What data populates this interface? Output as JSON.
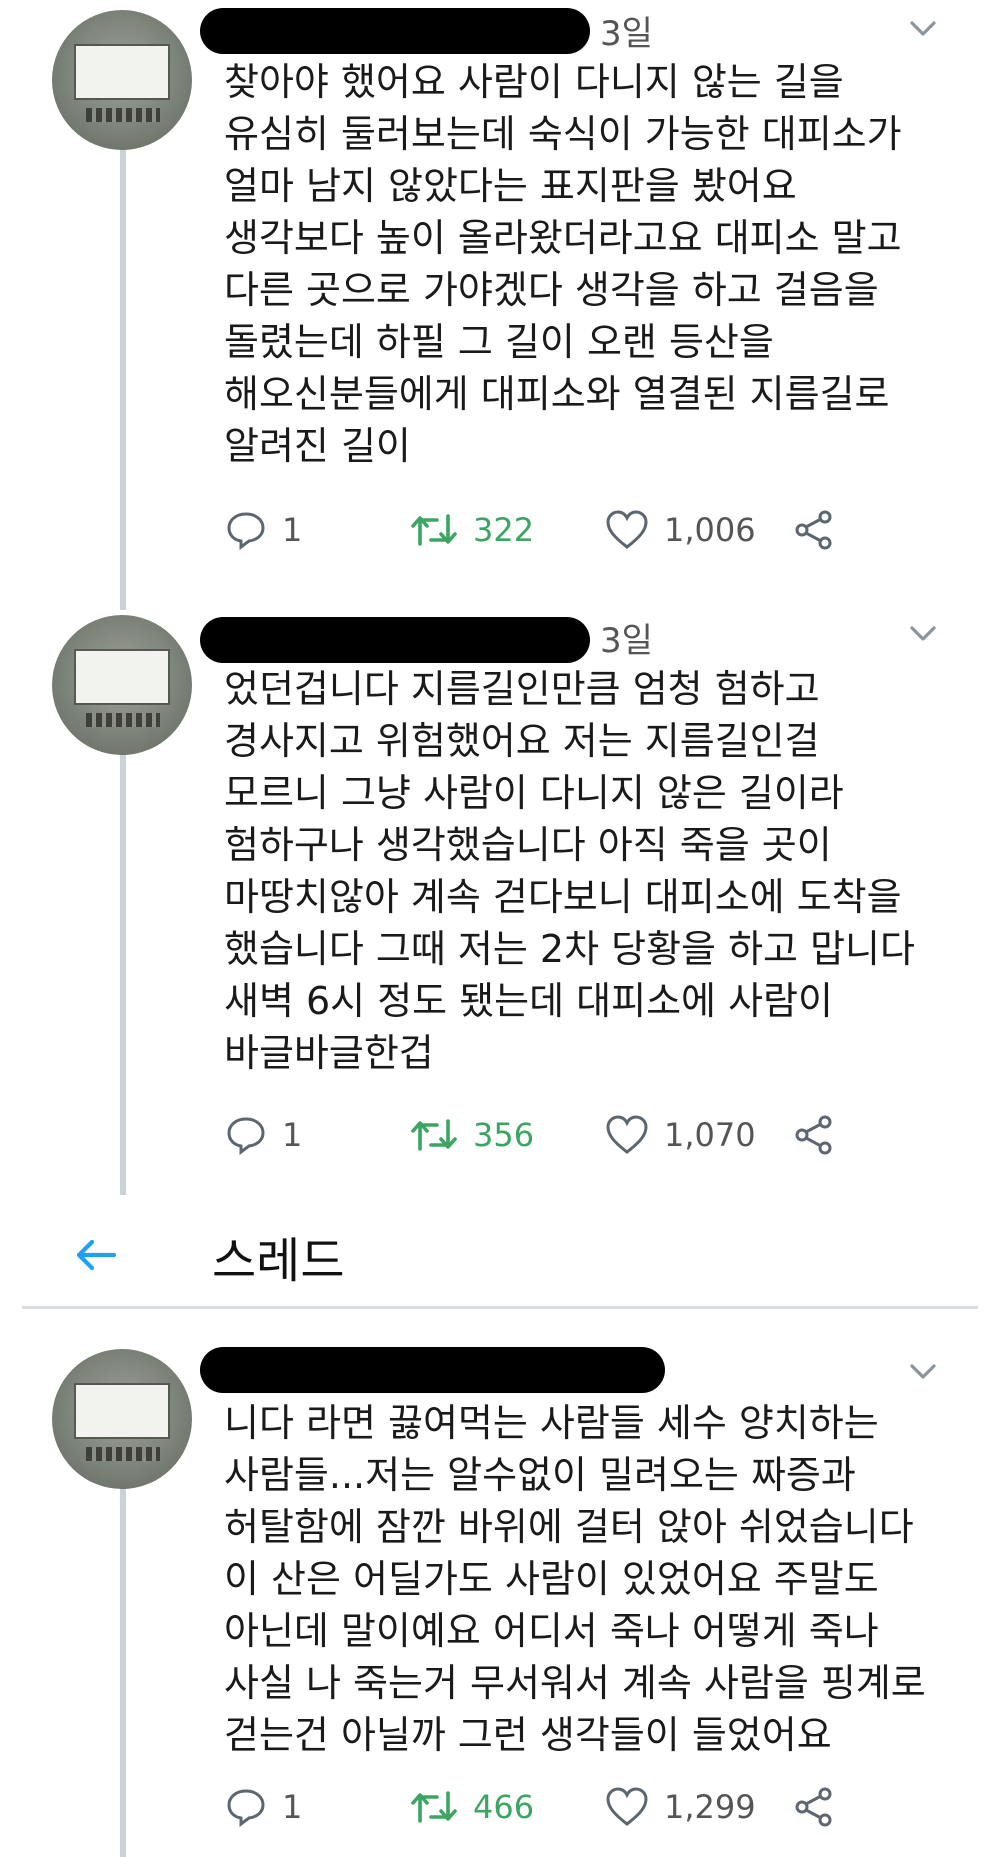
{
  "header": {
    "title": "스레드"
  },
  "tweets": [
    {
      "time": "3일",
      "lines": [
        "찾아야 했어요 사람이 다니지 않는 길을",
        "유심히 둘러보는데 숙식이 가능한 대피소가",
        "얼마 남지 않았다는 표지판을 봤어요",
        "생각보다 높이 올라왔더라고요 대피소 말고",
        "다른 곳으로 가야겠다 생각을 하고 걸음을",
        "돌렸는데 하필 그 길이 오랜 등산을",
        "해오신분들에게 대피소와 열결된 지름길로",
        "알려진 길이"
      ],
      "replies": "1",
      "retweets": "322",
      "likes": "1,006"
    },
    {
      "time": "3일",
      "lines": [
        "었던겁니다 지름길인만큼 엄청 험하고",
        "경사지고 위험했어요 저는 지름길인걸",
        "모르니 그냥 사람이 다니지 않은 길이라",
        "험하구나 생각했습니다 아직 죽을 곳이",
        "마땅치않아 계속 걷다보니 대피소에 도착을",
        "했습니다 그때 저는 2차 당황을 하고 맙니다",
        "새벽 6시 정도 됐는데 대피소에 사람이",
        "바글바글한겁"
      ],
      "replies": "1",
      "retweets": "356",
      "likes": "1,070"
    },
    {
      "time": "",
      "lines": [
        "니다 라면 끓여먹는 사람들 세수 양치하는",
        "사람들...저는 알수없이 밀려오는 짜증과",
        "허탈함에 잠깐 바위에 걸터 앉아 쉬었습니다",
        "이 산은 어딜가도 사람이 있었어요 주말도",
        "아닌데 말이예요 어디서 죽나 어떻게 죽나",
        "사실 나 죽는거 무서워서 계속 사람을 핑계로",
        "걷는건 아닐까 그런 생각들이 들었어요"
      ],
      "replies": "1",
      "retweets": "466",
      "likes": "1,299"
    }
  ],
  "colors": {
    "retweet_green": "#3ba561",
    "back_arrow_blue": "#1da1f2",
    "icon_gray": "#5b6670"
  },
  "icons": {
    "reply": "reply-icon",
    "retweet": "retweet-icon",
    "like": "heart-icon",
    "share": "share-icon",
    "more": "chevron-down-icon",
    "back": "back-arrow-icon"
  }
}
